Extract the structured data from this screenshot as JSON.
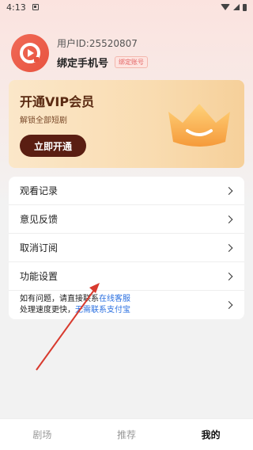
{
  "status_bar": {
    "time": "4:13"
  },
  "profile": {
    "user_id": "用户ID:25520807",
    "bind_phone": "绑定手机号",
    "bind_tag": "绑定账号"
  },
  "vip": {
    "title": "开通VIP会员",
    "subtitle": "解锁全部短剧",
    "button": "立即开通"
  },
  "menu": {
    "items": [
      {
        "label": "观看记录"
      },
      {
        "label": "意见反馈"
      },
      {
        "label": "取消订阅"
      },
      {
        "label": "功能设置"
      }
    ],
    "help": {
      "line1_text": "如有问题，请直接联系",
      "line1_link": "在线客服",
      "line2_text": "处理速度更快，",
      "line2_link": "无需联系支付宝"
    }
  },
  "tabbar": {
    "tabs": [
      {
        "label": "剧场",
        "active": false
      },
      {
        "label": "推荐",
        "active": false
      },
      {
        "label": "我的",
        "active": true
      }
    ]
  },
  "colors": {
    "accent": "#e8533f",
    "vip_button": "#5a1e12",
    "link": "#2a6fe0",
    "annotation_arrow": "#d83a2e"
  }
}
